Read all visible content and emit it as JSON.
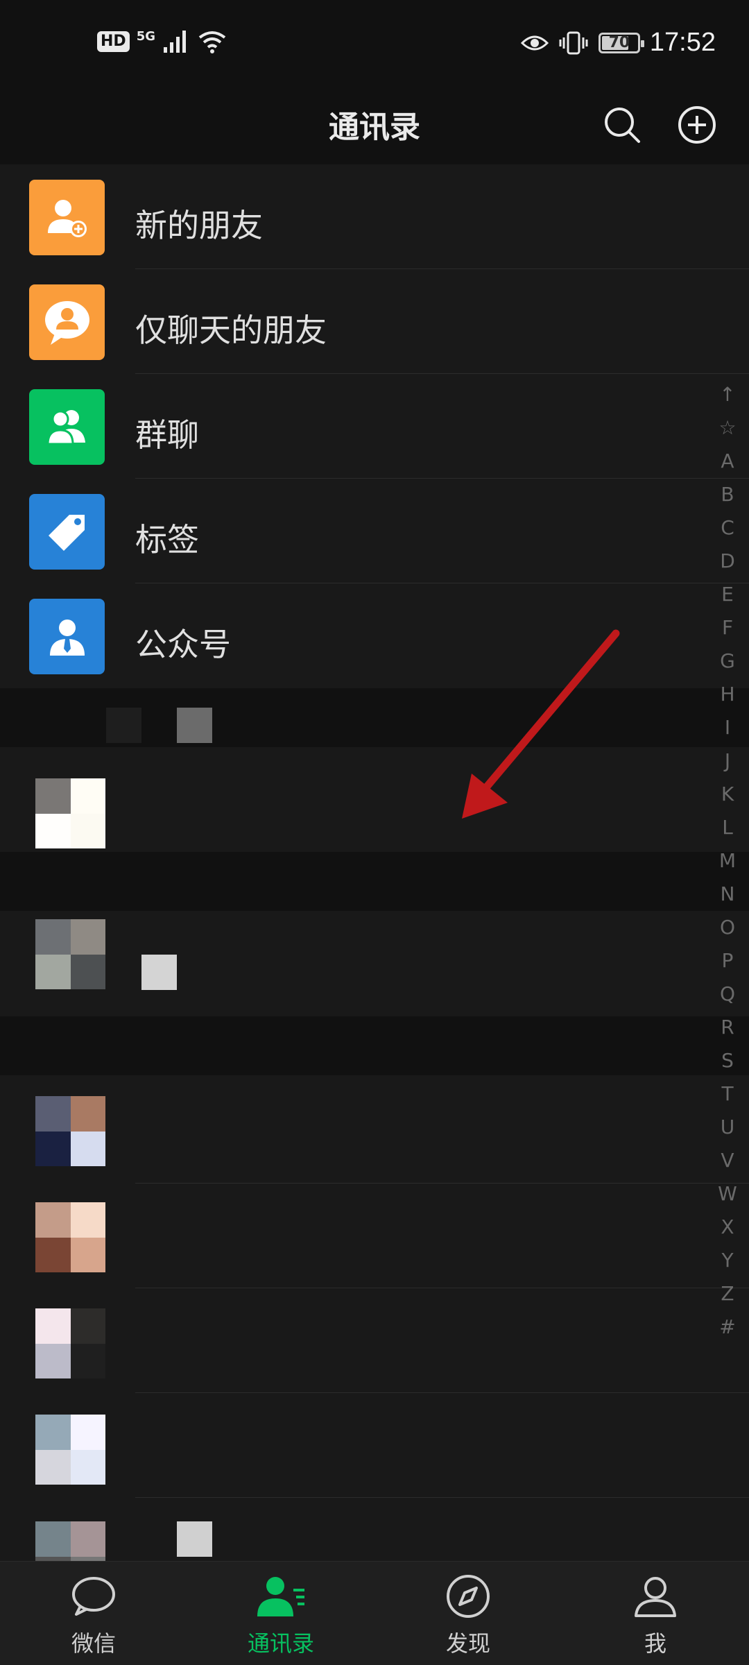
{
  "status": {
    "left_badge": "HD",
    "network": "5G",
    "battery_level": "70",
    "time": "17:52"
  },
  "header": {
    "title": "通讯录"
  },
  "functions": [
    {
      "label": "新的朋友",
      "icon": "add-friend-icon",
      "color": "#fa9d3b"
    },
    {
      "label": "仅聊天的朋友",
      "icon": "chat-only-friend-icon",
      "color": "#fa9d3b"
    },
    {
      "label": "群聊",
      "icon": "group-chat-icon",
      "color": "#07c160"
    },
    {
      "label": "标签",
      "icon": "tag-icon",
      "color": "#2782d7"
    },
    {
      "label": "公众号",
      "icon": "official-account-icon",
      "color": "#2782d7"
    }
  ],
  "index_letters": [
    "↑",
    "☆",
    "A",
    "B",
    "C",
    "D",
    "E",
    "F",
    "G",
    "H",
    "I",
    "J",
    "K",
    "L",
    "M",
    "N",
    "O",
    "P",
    "Q",
    "R",
    "S",
    "T",
    "U",
    "V",
    "W",
    "X",
    "Y",
    "Z",
    "#"
  ],
  "tabs": [
    {
      "label": "微信",
      "icon": "chat-bubble-icon",
      "active": false
    },
    {
      "label": "通讯录",
      "icon": "contacts-icon",
      "active": true
    },
    {
      "label": "发现",
      "icon": "compass-icon",
      "active": false
    },
    {
      "label": "我",
      "icon": "person-icon",
      "active": false
    }
  ],
  "colors": {
    "accent": "#07c160",
    "annotation_arrow": "#c0191b",
    "background": "#191919"
  }
}
